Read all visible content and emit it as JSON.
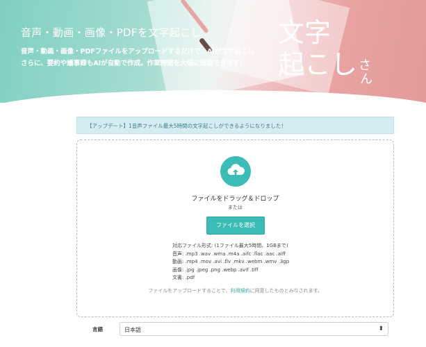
{
  "hero": {
    "title": "音声・動画・画像・PDFを文字起こし",
    "subtitle_line1": "音声・動画・画像・PDFファイルをアップロードするだけで、AIが文字起こし",
    "subtitle_line2": "さらに、要約や議事録もAIが自動で作成。作業時間を大幅に短縮できます！",
    "big_line1": "文字",
    "big_line2": "起こし",
    "big_small": "さ",
    "big_small2": "ん"
  },
  "notice": {
    "text": "【アップデート】1音声ファイル最大5時間の文字起こしができるようになりました！"
  },
  "dropzone": {
    "icon": "cloud-upload-icon",
    "title": "ファイルをドラッグ＆ドロップ",
    "or": "または",
    "select_button": "ファイルを選択",
    "formats": [
      "対応ファイル形式: (1ファイル最大5時間、1GBまで)",
      "音声: .mp3 .wav .wma .m4a .aifc .flac .aac .aiff",
      "動画: .mp4 .mov .avi .flv .mkv .webm .wmv .3gp",
      "画像: .jpg .jpeg .png .webp .avif .tiff",
      "文書: .pdf"
    ],
    "consent_before": "ファイルをアップロードすることで、",
    "consent_link": "利用規約",
    "consent_after": "に同意したものとみなされます。"
  },
  "language": {
    "label": "言語",
    "value": "日本語"
  },
  "colors": {
    "accent": "#3bbcb6",
    "notice_bg": "#d5ecf0",
    "hero_left": "#7fcfc3",
    "hero_right": "#e29a9a"
  }
}
